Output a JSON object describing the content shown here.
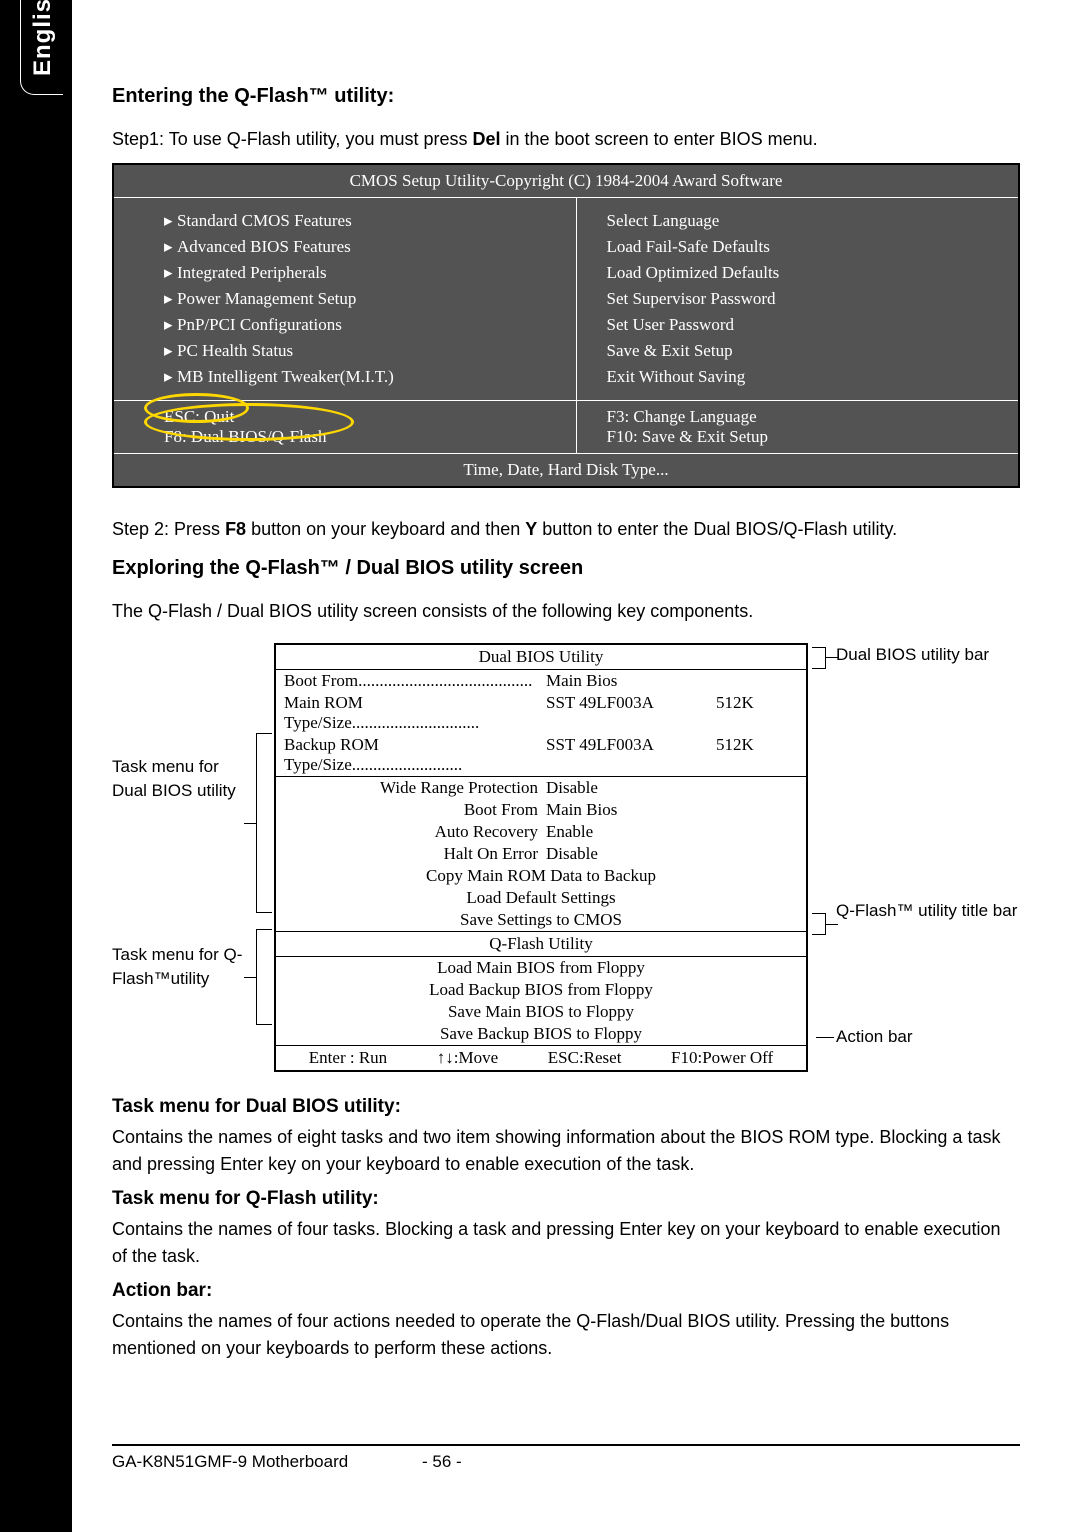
{
  "language_tab": "English",
  "section1": {
    "heading": "Entering the Q-Flash™ utility:",
    "step1_pre": "Step1: To use Q-Flash utility, you must press ",
    "step1_key": "Del",
    "step1_post": " in the boot screen to enter BIOS menu."
  },
  "bios1": {
    "title": "CMOS Setup Utility-Copyright (C) 1984-2004 Award Software",
    "left": [
      "Standard CMOS Features",
      "Advanced BIOS Features",
      "Integrated Peripherals",
      "Power Management Setup",
      "PnP/PCI Configurations",
      "PC Health Status",
      "MB Intelligent Tweaker(M.I.T.)"
    ],
    "right": [
      "Select Language",
      "Load Fail-Safe Defaults",
      "Load Optimized Defaults",
      "Set Supervisor Password",
      "Set User Password",
      "Save & Exit Setup",
      "Exit Without Saving"
    ],
    "footer1": {
      "l1": "ESC: Quit",
      "l2": "F8: Dual BIOS/Q-Flash",
      "r1": "F3: Change Language",
      "r2": "F10: Save & Exit Setup"
    },
    "footer2": "Time, Date, Hard Disk Type..."
  },
  "step2_pre": "Step 2: Press ",
  "step2_key1": "F8",
  "step2_mid": " button on your keyboard and then ",
  "step2_key2": "Y",
  "step2_post": " button to enter the Dual BIOS/Q-Flash utility.",
  "section2": {
    "heading": "Exploring the Q-Flash™ / Dual BIOS utility screen",
    "intro": "The Q-Flash / Dual BIOS utility screen consists of the following key components."
  },
  "labels": {
    "left_dualbios": "Task menu for Dual BIOS utility",
    "left_qflash": "Task menu for Q-Flash™utility",
    "right_dualbios_bar": "Dual BIOS utility bar",
    "right_qflash_bar": "Q-Flash™ utility title bar",
    "right_action_bar": "Action bar"
  },
  "dualbios": {
    "title": "Dual BIOS Utility",
    "bootfrom_label": "Boot From.........................................",
    "bootfrom_value": "Main Bios",
    "mainrom_label": "Main ROM Type/Size..............................",
    "mainrom_value": "SST 49LF003A",
    "mainrom_size": "512K",
    "backrom_label": "Backup ROM Type/Size..........................",
    "backrom_value": "SST 49LF003A",
    "backrom_size": "512K",
    "settings": [
      {
        "k": "Wide Range Protection",
        "v": "Disable"
      },
      {
        "k": "Boot From",
        "v": "Main Bios"
      },
      {
        "k": "Auto Recovery",
        "v": "Enable"
      },
      {
        "k": "Halt On Error",
        "v": "Disable"
      }
    ],
    "cmds": [
      "Copy Main ROM Data to Backup",
      "Load Default Settings",
      "Save Settings to CMOS"
    ],
    "qflash_title": "Q-Flash Utility",
    "qflash_items": [
      "Load Main BIOS from Floppy",
      "Load Backup BIOS from Floppy",
      "Save Main BIOS to Floppy",
      "Save Backup BIOS to Floppy"
    ],
    "actions": [
      "Enter : Run",
      "↑↓:Move",
      "ESC:Reset",
      "F10:Power Off"
    ]
  },
  "desc": {
    "h_dualbios": "Task menu for Dual BIOS utility:",
    "p_dualbios": "Contains the names of eight tasks and two item showing information about the BIOS ROM type. Blocking a task and pressing Enter key on your keyboard to enable execution of the task.",
    "h_qflash": "Task menu for Q-Flash utility:",
    "p_qflash": "Contains the names of four tasks. Blocking a task and pressing Enter key on your keyboard to enable execution of the task.",
    "h_action": "Action bar:",
    "p_action": "Contains the names of four actions needed to operate the Q-Flash/Dual BIOS utility. Pressing the buttons mentioned on your keyboards to perform these actions."
  },
  "footer": {
    "product": "GA-K8N51GMF-9 Motherboard",
    "page": "- 56 -"
  }
}
